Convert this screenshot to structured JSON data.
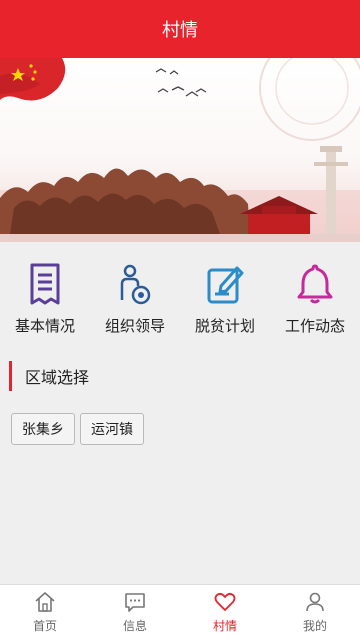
{
  "header": {
    "title": "村情"
  },
  "banner": {
    "image": "banner-red-theme"
  },
  "quick_links": [
    {
      "label": "基本情况",
      "icon": "document-list-icon",
      "color": "#5a3f98"
    },
    {
      "label": "组织领导",
      "icon": "person-badge-icon",
      "color": "#2a5c9a"
    },
    {
      "label": "脱贫计划",
      "icon": "edit-note-icon",
      "color": "#2a8cc8"
    },
    {
      "label": "工作动态",
      "icon": "bell-icon",
      "color": "#c42a9a"
    }
  ],
  "region": {
    "title": "区域选择",
    "options": [
      "张集乡",
      "运河镇"
    ]
  },
  "tabbar": {
    "items": [
      {
        "label": "首页",
        "icon": "home-icon",
        "active": false
      },
      {
        "label": "信息",
        "icon": "message-icon",
        "active": false
      },
      {
        "label": "村情",
        "icon": "heart-icon",
        "active": true
      },
      {
        "label": "我的",
        "icon": "user-icon",
        "active": false
      }
    ]
  },
  "colors": {
    "accent": "#e8232b",
    "background": "#efefef"
  }
}
